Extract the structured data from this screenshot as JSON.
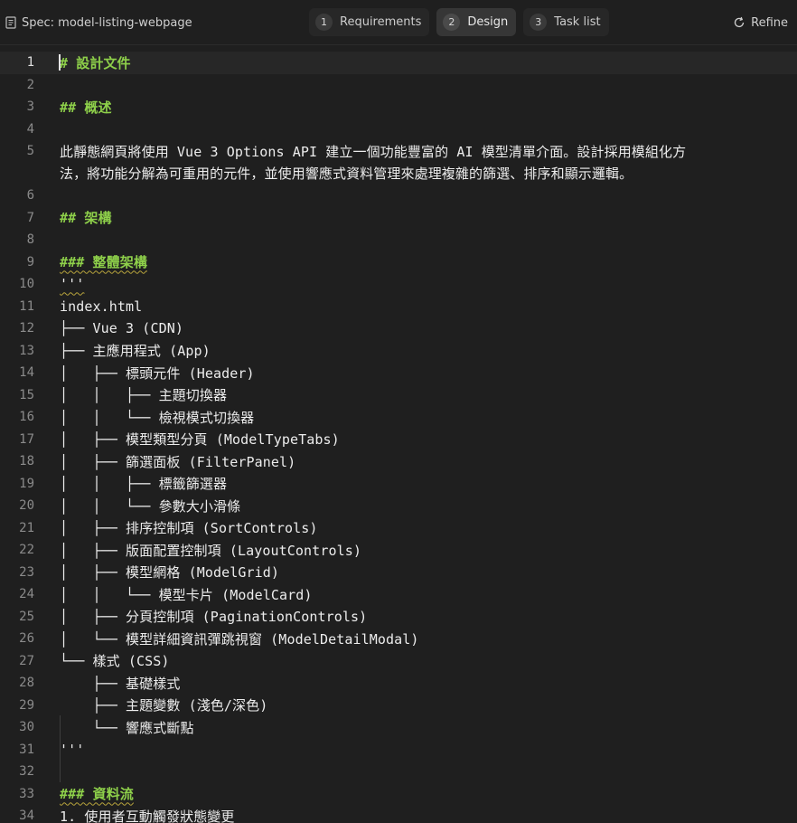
{
  "header": {
    "spec_label": "Spec: model-listing-webpage",
    "tabs": [
      {
        "num": "1",
        "label": "Requirements"
      },
      {
        "num": "2",
        "label": "Design"
      },
      {
        "num": "3",
        "label": "Task list"
      }
    ],
    "refine_label": "Refine"
  },
  "editor": {
    "current_line": 1,
    "lines": [
      {
        "n": "1",
        "text": "# 設計文件"
      },
      {
        "n": "2",
        "text": ""
      },
      {
        "n": "3",
        "text": "## 概述"
      },
      {
        "n": "4",
        "text": ""
      },
      {
        "n": "5",
        "text": "此靜態網頁將使用 Vue 3 Options API 建立一個功能豐富的 AI 模型清單介面。設計採用模組化方"
      },
      {
        "n": "",
        "text": "法，將功能分解為可重用的元件，並使用響應式資料管理來處理複雜的篩選、排序和顯示邏輯。"
      },
      {
        "n": "6",
        "text": ""
      },
      {
        "n": "7",
        "text": "## 架構"
      },
      {
        "n": "8",
        "text": ""
      },
      {
        "n": "9",
        "text": "### 整體架構"
      },
      {
        "n": "10",
        "text": "'''"
      },
      {
        "n": "11",
        "text": "index.html"
      },
      {
        "n": "12",
        "text": "├── Vue 3 (CDN)"
      },
      {
        "n": "13",
        "text": "├── 主應用程式 (App)"
      },
      {
        "n": "14",
        "text": "│   ├── 標頭元件 (Header)"
      },
      {
        "n": "15",
        "text": "│   │   ├── 主題切換器"
      },
      {
        "n": "16",
        "text": "│   │   └── 檢視模式切換器"
      },
      {
        "n": "17",
        "text": "│   ├── 模型類型分頁 (ModelTypeTabs)"
      },
      {
        "n": "18",
        "text": "│   ├── 篩選面板 (FilterPanel)"
      },
      {
        "n": "19",
        "text": "│   │   ├── 標籤篩選器"
      },
      {
        "n": "20",
        "text": "│   │   └── 參數大小滑條"
      },
      {
        "n": "21",
        "text": "│   ├── 排序控制項 (SortControls)"
      },
      {
        "n": "22",
        "text": "│   ├── 版面配置控制項 (LayoutControls)"
      },
      {
        "n": "23",
        "text": "│   ├── 模型網格 (ModelGrid)"
      },
      {
        "n": "24",
        "text": "│   │   └── 模型卡片 (ModelCard)"
      },
      {
        "n": "25",
        "text": "│   ├── 分頁控制項 (PaginationControls)"
      },
      {
        "n": "26",
        "text": "│   └── 模型詳細資訊彈跳視窗 (ModelDetailModal)"
      },
      {
        "n": "27",
        "text": "└── 樣式 (CSS)"
      },
      {
        "n": "28",
        "text": "    ├── 基礎樣式"
      },
      {
        "n": "29",
        "text": "    ├── 主題變數 (淺色/深色)"
      },
      {
        "n": "30",
        "text": "    └── 響應式斷點"
      },
      {
        "n": "31",
        "text": "'''"
      },
      {
        "n": "32",
        "text": ""
      },
      {
        "n": "33",
        "text": "### 資料流"
      },
      {
        "n": "34",
        "text": "1. 使用者互動觸發狀態變更"
      }
    ]
  }
}
